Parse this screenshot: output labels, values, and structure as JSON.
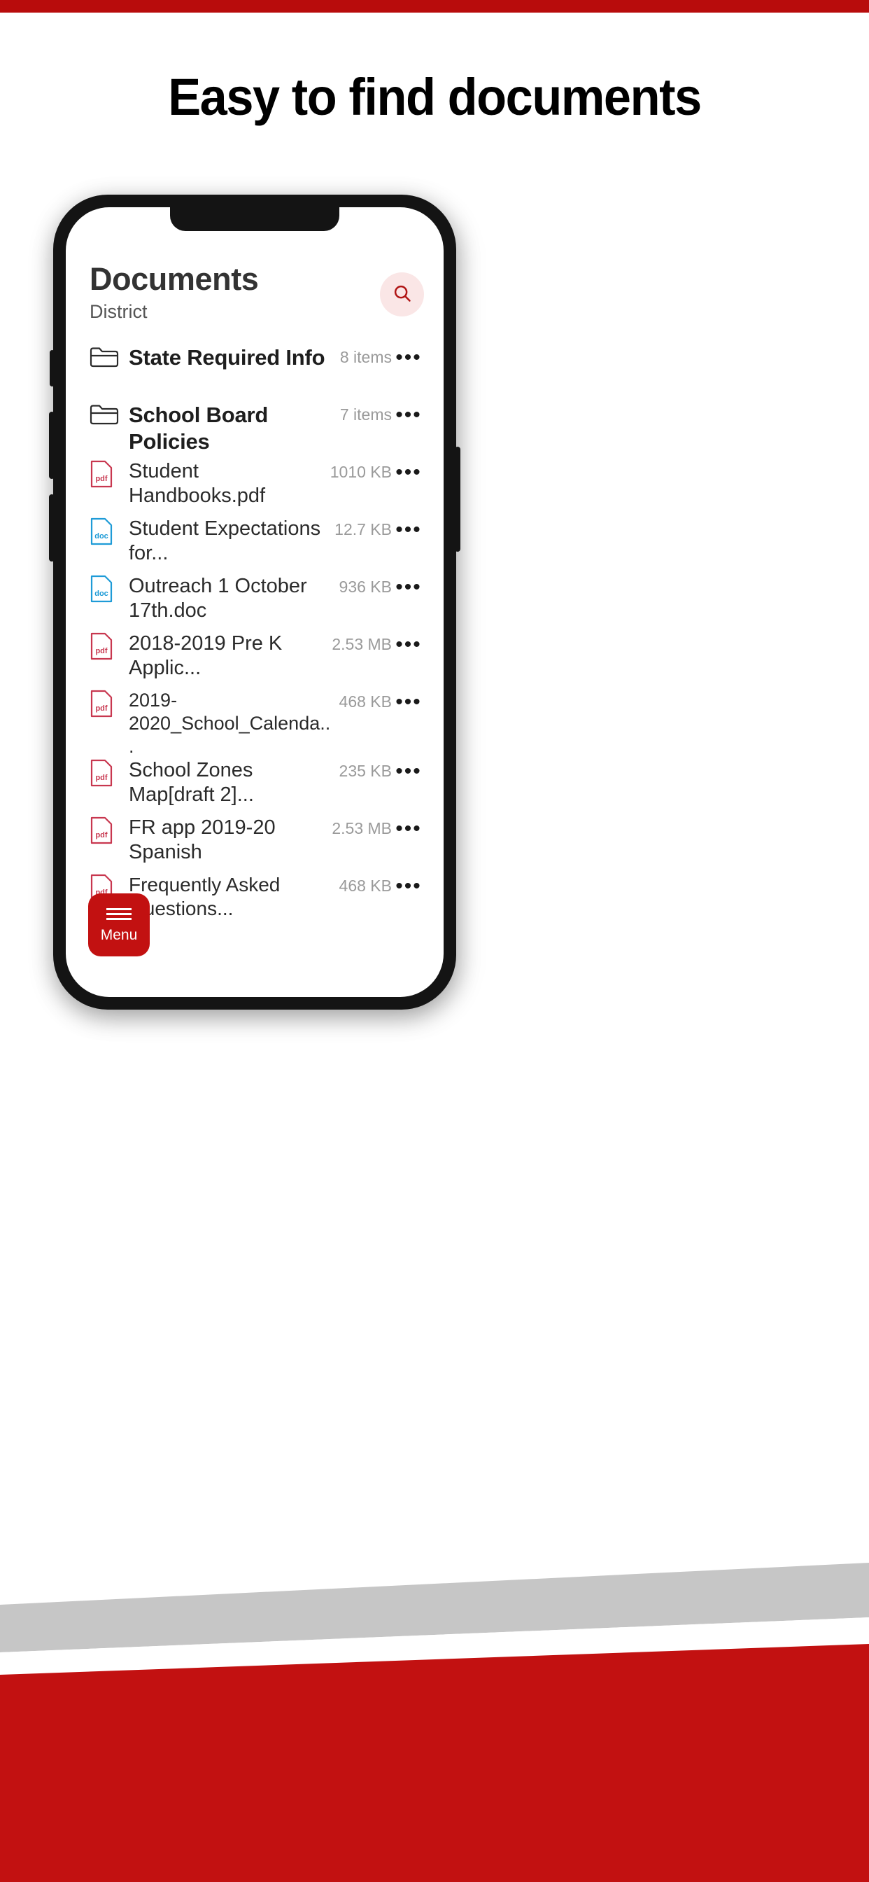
{
  "page": {
    "headline": "Easy to find documents",
    "top_bar_color": "#B80C0C",
    "accent_red": "#C21111",
    "deco_gray": "#C6C6C6"
  },
  "app": {
    "title": "Documents",
    "subtitle": "District",
    "search": {
      "icon": "search-icon",
      "bg_color": "#FAE6E6",
      "icon_color": "#B01515"
    },
    "menu_button": {
      "label": "Menu",
      "icon": "hamburger-icon",
      "color": "#C21111"
    },
    "more_glyph": "•••",
    "items": [
      {
        "kind": "folder",
        "icon": "folder-icon",
        "name": "State Required Info",
        "meta": "8 items"
      },
      {
        "kind": "folder",
        "icon": "folder-icon",
        "name": "School Board Policies",
        "meta": "7 items"
      },
      {
        "kind": "pdf",
        "icon": "pdf-file-icon",
        "name": "Student Handbooks.pdf",
        "meta": "1010 KB"
      },
      {
        "kind": "doc",
        "icon": "doc-file-icon",
        "name": "Student Expectations for...",
        "meta": "12.7 KB"
      },
      {
        "kind": "doc",
        "icon": "doc-file-icon",
        "name": "Outreach 1 October 17th.doc",
        "meta": "936 KB"
      },
      {
        "kind": "pdf",
        "icon": "pdf-file-icon",
        "name": "2018-2019 Pre K Applic...",
        "meta": "2.53 MB"
      },
      {
        "kind": "pdf",
        "icon": "pdf-file-icon",
        "name": "2019-2020_School_Calenda...",
        "meta": "468 KB"
      },
      {
        "kind": "pdf",
        "icon": "pdf-file-icon",
        "name": "School Zones Map[draft 2]...",
        "meta": "235 KB"
      },
      {
        "kind": "pdf",
        "icon": "pdf-file-icon",
        "name": "FR app 2019-20 Spanish",
        "meta": "2.53 MB"
      },
      {
        "kind": "pdf",
        "icon": "pdf-file-icon",
        "name": "Frequently Asked Questions...",
        "meta": "468 KB"
      }
    ],
    "file_label_pdf": "pdf",
    "file_label_doc": "doc",
    "colors": {
      "pdf": "#C8374F",
      "doc": "#1E9BD7"
    }
  }
}
